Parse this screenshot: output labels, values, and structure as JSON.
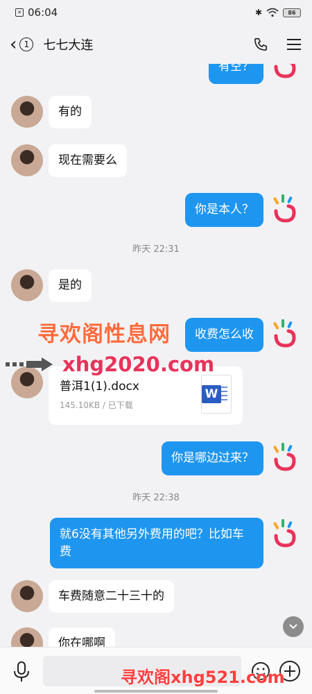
{
  "status_bar": {
    "time": "06:04",
    "battery": "86"
  },
  "header": {
    "unread_count": "1",
    "title": "七七大连"
  },
  "messages": [
    {
      "side": "right",
      "text": "有空？"
    },
    {
      "side": "left",
      "text": "有的"
    },
    {
      "side": "left",
      "text": "现在需要么"
    },
    {
      "side": "right",
      "text": "你是本人？"
    },
    {
      "type": "time",
      "text": "昨天 22:31"
    },
    {
      "side": "left",
      "text": "是的"
    },
    {
      "side": "right",
      "text": "收费怎么收"
    },
    {
      "side": "left",
      "type": "file",
      "name": "普洱1(1).docx",
      "meta": "145.10KB / 已下载"
    },
    {
      "side": "right",
      "text": "你是哪边过来？"
    },
    {
      "type": "time",
      "text": "昨天 22:38"
    },
    {
      "side": "right",
      "text": "就6没有其他另外费用的吧？比如车费"
    },
    {
      "side": "left",
      "text": "车费随意二十三十的"
    },
    {
      "side": "left",
      "text": "你在哪啊"
    }
  ],
  "watermarks": {
    "line1": "寻欢阁性息网",
    "line2": "xhg2020.com",
    "line3": "寻欢阁xhg521.com"
  },
  "input": {
    "placeholder": ""
  },
  "colors": {
    "bubble_blue": "#1e96f0",
    "background": "#f2f2f4"
  }
}
